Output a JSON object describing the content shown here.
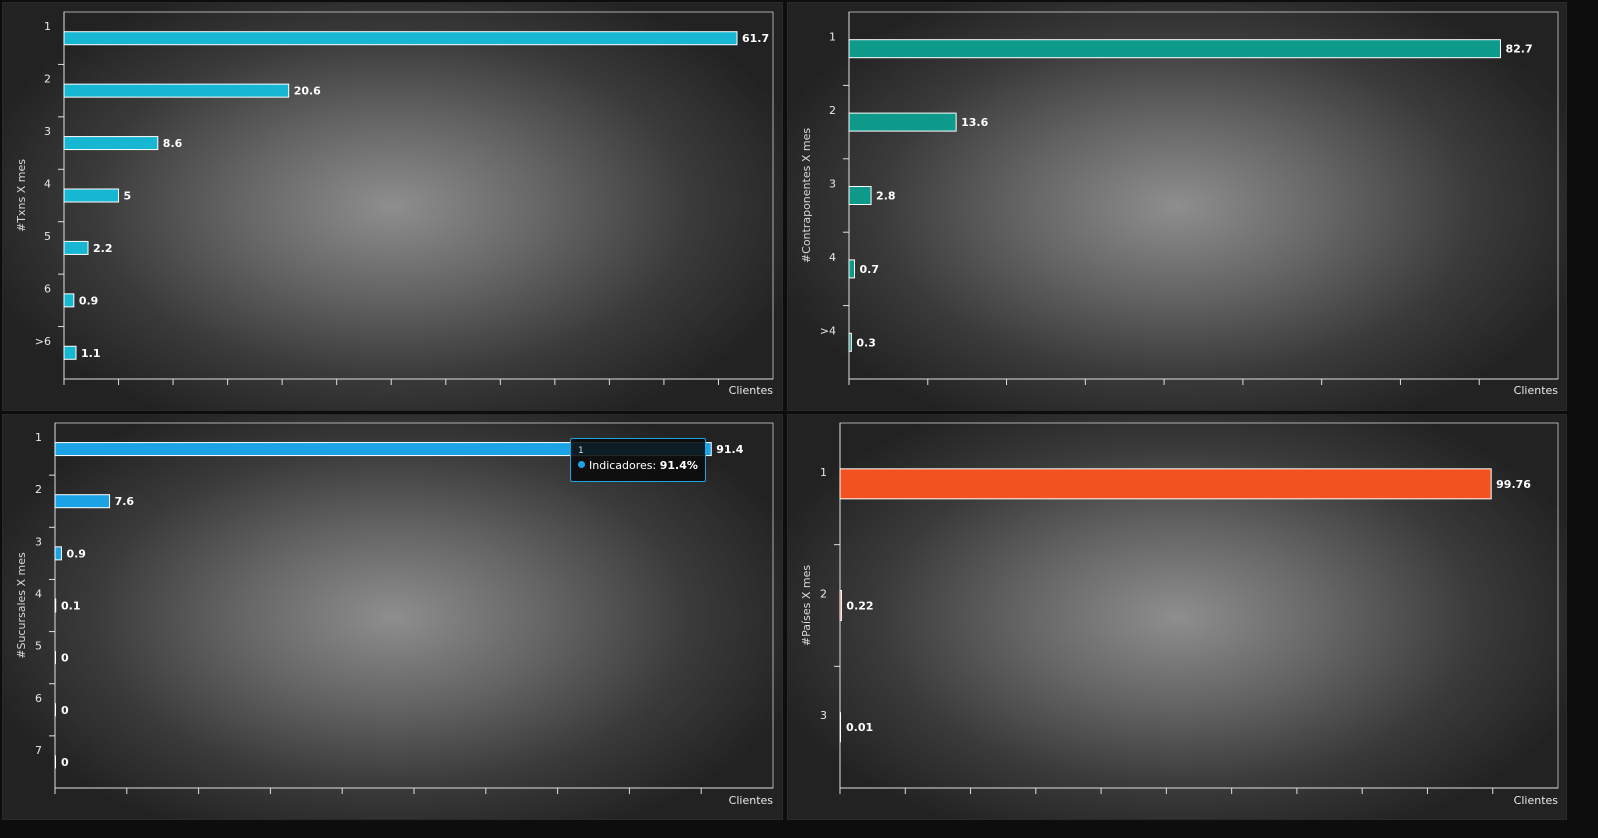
{
  "chart_data": [
    {
      "type": "bar",
      "orientation": "horizontal",
      "ylabel": "#Txns X mes",
      "xlabel": "Clientes",
      "categories": [
        "1",
        "2",
        "3",
        "4",
        "5",
        "6",
        ">6"
      ],
      "values": [
        61.7,
        20.6,
        8.6,
        5,
        2.2,
        0.9,
        1.1
      ],
      "value_labels": [
        "61.7",
        "20.6",
        "8.6",
        "5",
        "2.2",
        "0.9",
        "1.1"
      ],
      "xlim": [
        0,
        65
      ],
      "grid": false,
      "color": "#17b7d3"
    },
    {
      "type": "bar",
      "orientation": "horizontal",
      "ylabel": "#Contraponentes X mes",
      "xlabel": "Clientes",
      "categories": [
        "1",
        "2",
        "3",
        "4",
        ">4"
      ],
      "values": [
        82.7,
        13.6,
        2.8,
        0.7,
        0.3
      ],
      "value_labels": [
        "82.7",
        "13.6",
        "2.8",
        "0.7",
        "0.3"
      ],
      "xlim": [
        0,
        90
      ],
      "grid": false,
      "color": "#0e9a8a"
    },
    {
      "type": "bar",
      "orientation": "horizontal",
      "ylabel": "#Sucursales X mes",
      "xlabel": "Clientes",
      "categories": [
        "1",
        "2",
        "3",
        "4",
        "5",
        "6",
        "7"
      ],
      "values": [
        91.4,
        7.6,
        0.9,
        0.1,
        0,
        0,
        0
      ],
      "value_labels": [
        "91.4",
        "7.6",
        "0.9",
        "0.1",
        "0",
        "0",
        "0"
      ],
      "xlim": [
        0,
        100
      ],
      "grid": false,
      "color": "#1ca3e6",
      "tooltip": {
        "category": "1",
        "series": "Indicadores",
        "value": "91.4%"
      }
    },
    {
      "type": "bar",
      "orientation": "horizontal",
      "ylabel": "#Países X mes",
      "xlabel": "Clientes",
      "categories": [
        "1",
        "2",
        "3"
      ],
      "values": [
        99.76,
        0.22,
        0.01
      ],
      "value_labels": [
        "99.76",
        "0.22",
        "0.01"
      ],
      "xlim": [
        0,
        110
      ],
      "grid": false,
      "color": "#f25220"
    }
  ]
}
